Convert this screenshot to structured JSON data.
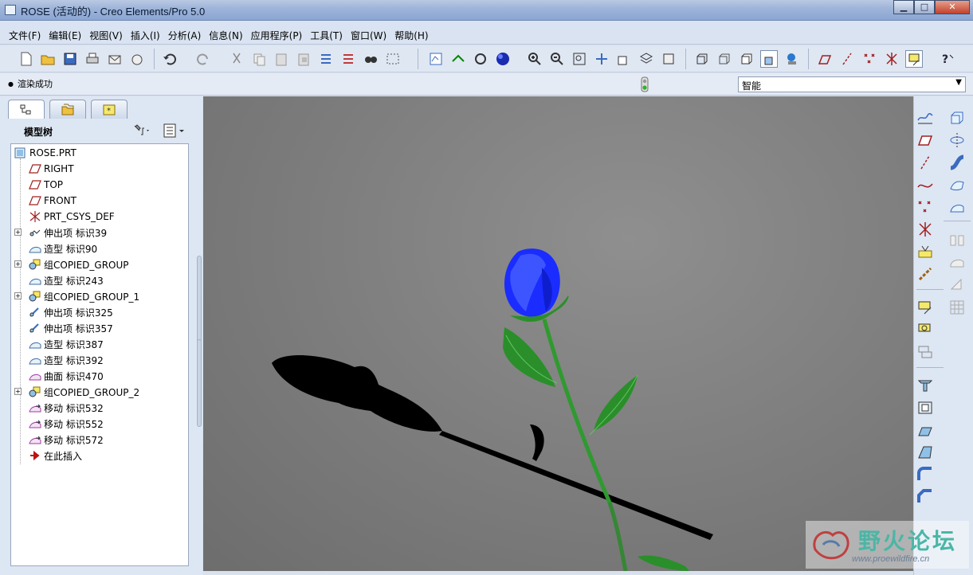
{
  "window": {
    "title": "ROSE (活动的) - Creo Elements/Pro 5.0",
    "minimize": "▁",
    "maximize": "□",
    "close": "✕"
  },
  "menu": {
    "items": [
      "文件(F)",
      "编辑(E)",
      "视图(V)",
      "插入(I)",
      "分析(A)",
      "信息(N)",
      "应用程序(P)",
      "工具(T)",
      "窗口(W)",
      "帮助(H)"
    ]
  },
  "status": {
    "message": "渲染成功",
    "filter_value": "智能",
    "filter_arrow": "▼"
  },
  "navigator": {
    "tree_title": "模型树",
    "tree_items": [
      {
        "label": "ROSE.PRT",
        "icon": "part-icon"
      },
      {
        "label": "RIGHT",
        "icon": "datum-plane-icon"
      },
      {
        "label": "TOP",
        "icon": "datum-plane-icon"
      },
      {
        "label": "FRONT",
        "icon": "datum-plane-icon"
      },
      {
        "label": "PRT_CSYS_DEF",
        "icon": "csys-icon"
      },
      {
        "label": "伸出项 标识39",
        "icon": "protrusion-icon"
      },
      {
        "label": "造型 标识90",
        "icon": "style-icon"
      },
      {
        "label": "组COPIED_GROUP",
        "icon": "group-icon"
      },
      {
        "label": "造型 标识243",
        "icon": "style-icon"
      },
      {
        "label": "组COPIED_GROUP_1",
        "icon": "group-icon"
      },
      {
        "label": "伸出项 标识325",
        "icon": "protrusion-icon"
      },
      {
        "label": "伸出项 标识357",
        "icon": "protrusion-icon"
      },
      {
        "label": "造型 标识387",
        "icon": "style-icon"
      },
      {
        "label": "造型 标识392",
        "icon": "style-icon"
      },
      {
        "label": "曲面 标识470",
        "icon": "surface-icon"
      },
      {
        "label": "组COPIED_GROUP_2",
        "icon": "group-icon"
      },
      {
        "label": "移动 标识532",
        "icon": "move-icon"
      },
      {
        "label": "移动 标识552",
        "icon": "move-icon"
      },
      {
        "label": "移动 标识572",
        "icon": "move-icon"
      },
      {
        "label": "在此插入",
        "icon": "insert-here-icon"
      }
    ]
  },
  "watermark": {
    "title": "野火论坛",
    "url": "www.proewildfire.cn"
  },
  "colors": {
    "viewport_bg": "#7c7c7c",
    "petal": "#1a2cff",
    "leaf": "#2f9a2f",
    "shadow": "#000000"
  }
}
